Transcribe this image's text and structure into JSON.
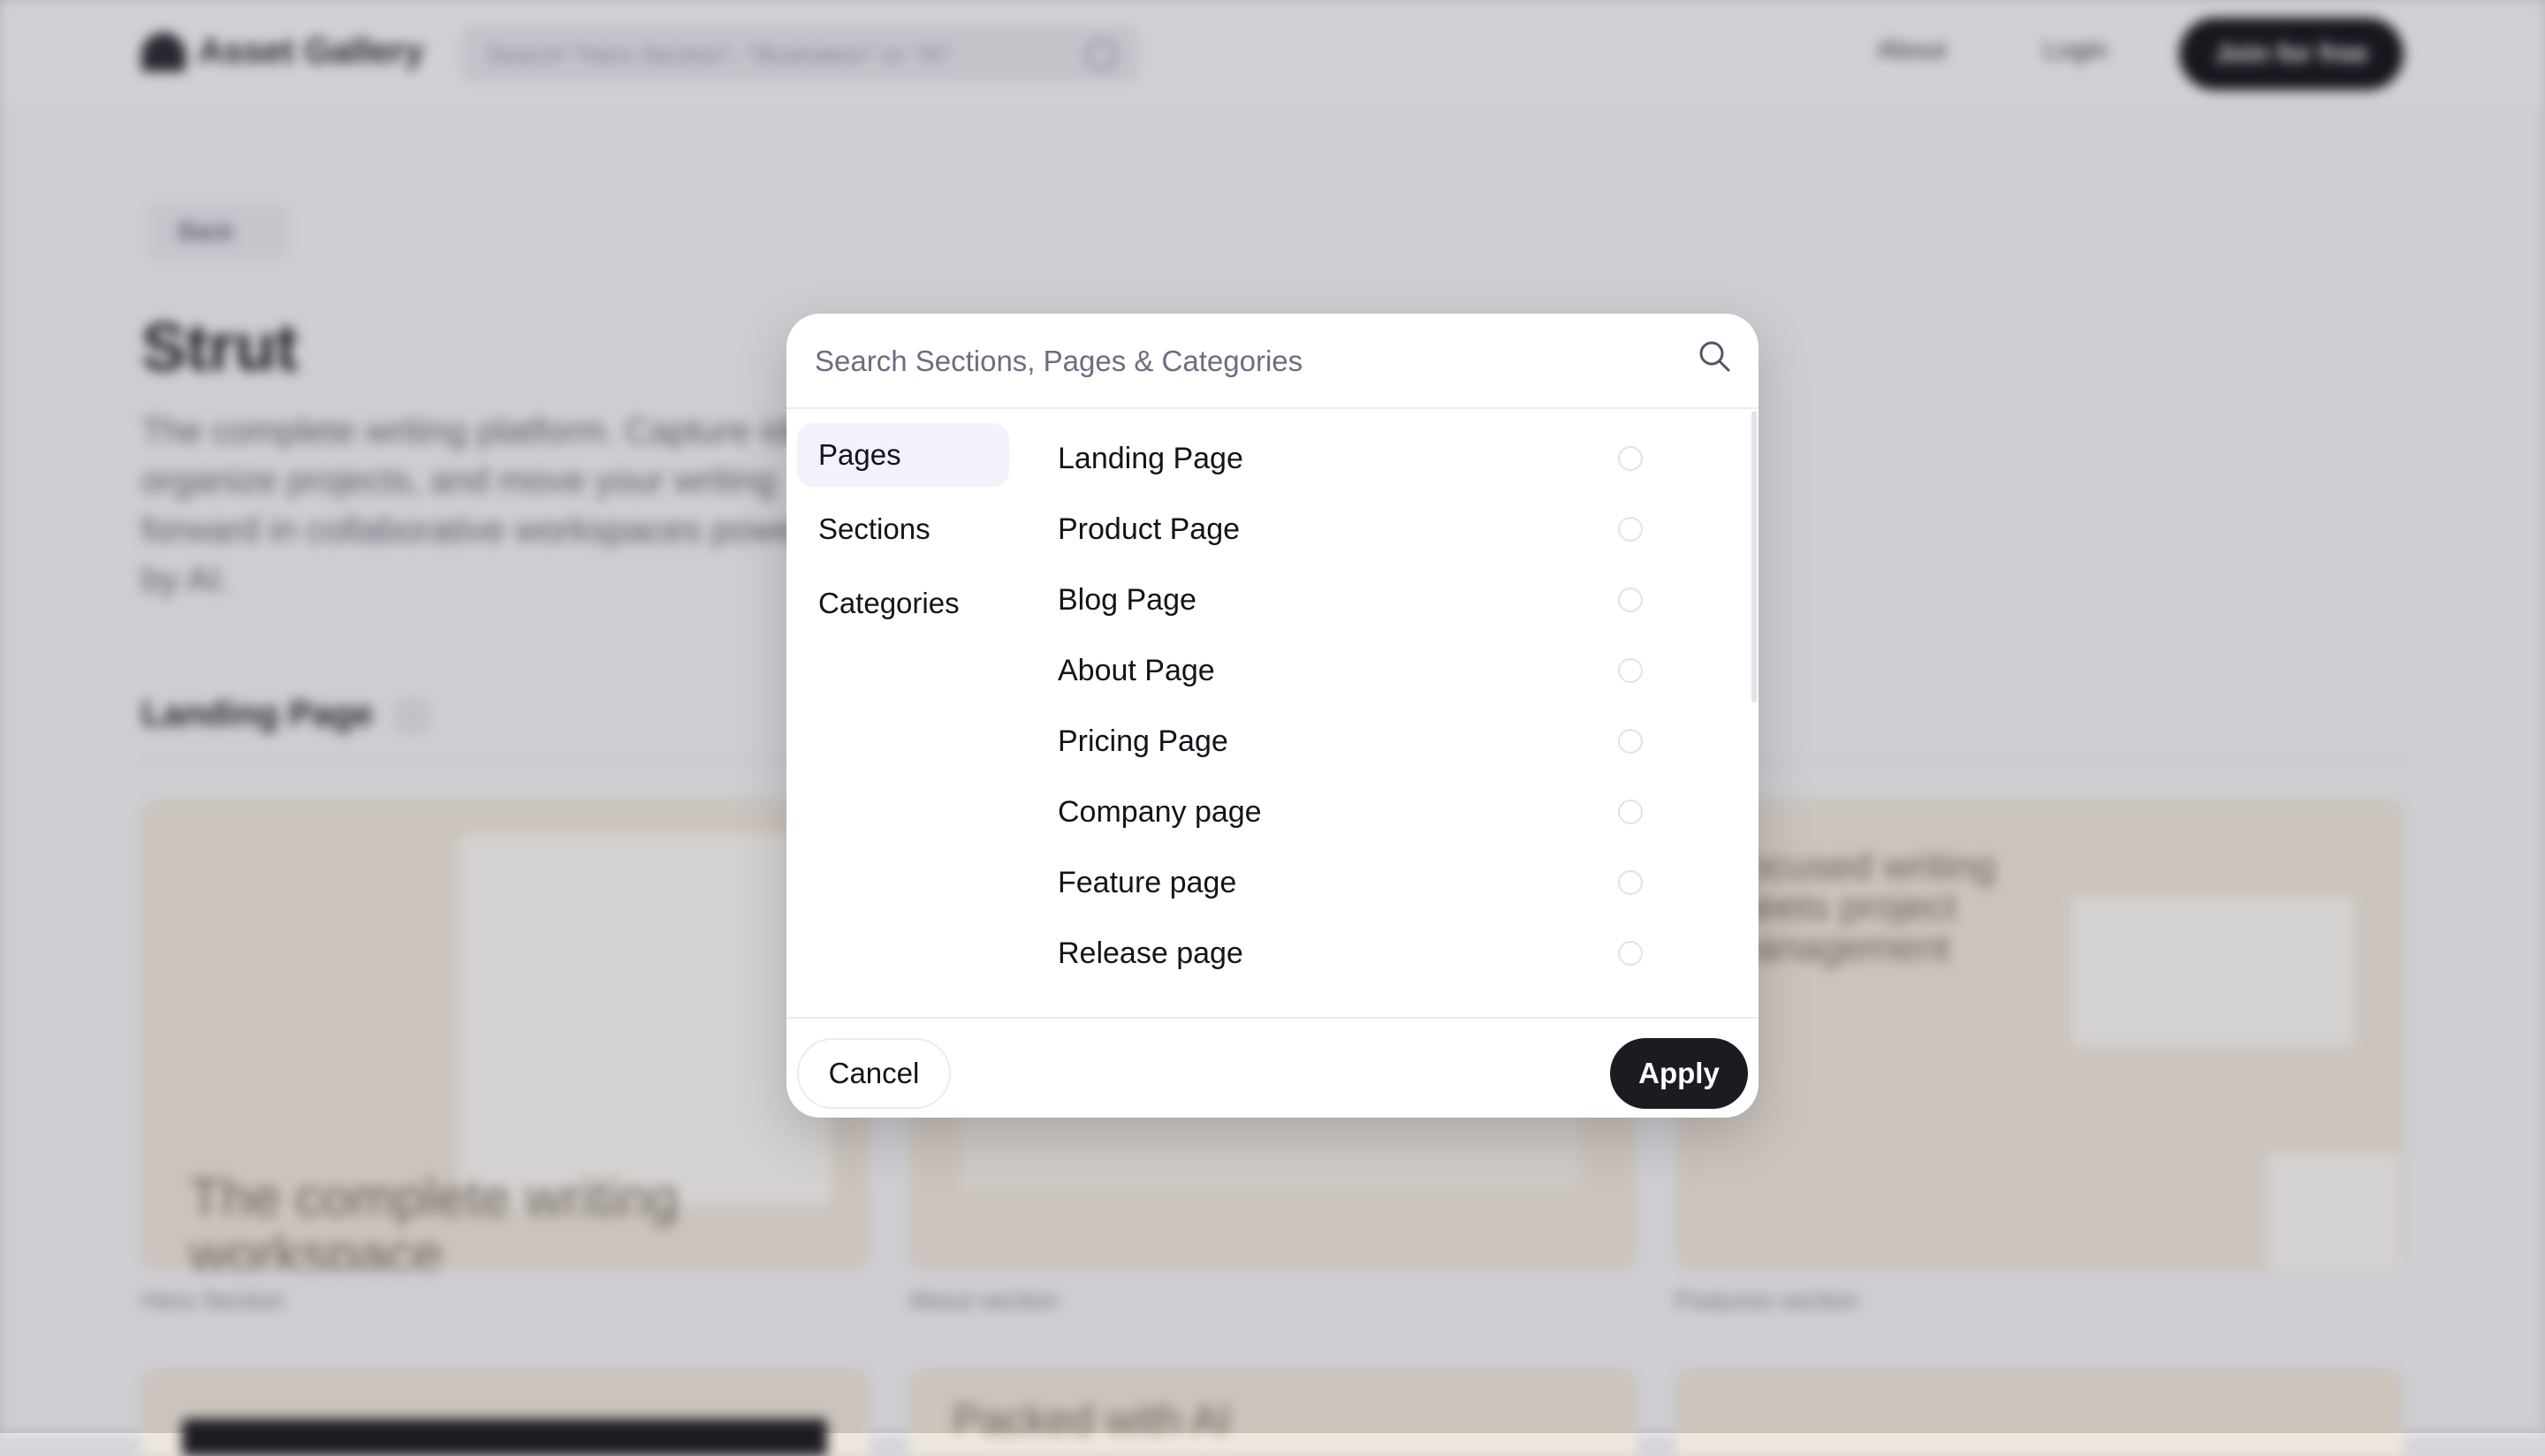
{
  "background": {
    "brand": "Asset Gallery",
    "search_placeholder": "Search \"Hero Section\", \"Illustration\" or \"AI\"",
    "nav": {
      "about": "About",
      "login": "Login",
      "join": "Join for free"
    },
    "back_label": "Back",
    "title": "Strut",
    "description": "The complete writing platform. Capture ideas, organize projects, and move your writing forward in collaborative workspaces powered by AI.",
    "section_title": "Landing Page",
    "cards": [
      {
        "label": "Hero Section",
        "text": "The complete writing workspace"
      },
      {
        "label": "About section",
        "text": ""
      },
      {
        "label": "Features section",
        "text": "Focused writing meets project management"
      }
    ],
    "row2_text": "Packed with AI"
  },
  "modal": {
    "search_placeholder": "Search Sections, Pages & Categories",
    "tabs": [
      {
        "label": "Pages",
        "active": true
      },
      {
        "label": "Sections",
        "active": false
      },
      {
        "label": "Categories",
        "active": false
      }
    ],
    "items": [
      {
        "label": "Landing Page",
        "selected": false
      },
      {
        "label": "Product Page",
        "selected": false
      },
      {
        "label": "Blog Page",
        "selected": false
      },
      {
        "label": "About Page",
        "selected": false
      },
      {
        "label": "Pricing Page",
        "selected": false
      },
      {
        "label": "Company page",
        "selected": false
      },
      {
        "label": "Feature page",
        "selected": false
      },
      {
        "label": "Release page",
        "selected": false
      }
    ],
    "cancel_label": "Cancel",
    "apply_label": "Apply"
  },
  "colors": {
    "primary_button": "#1c1b21",
    "active_tab": "#f3f2fb",
    "overlay": "#d6d5da"
  }
}
